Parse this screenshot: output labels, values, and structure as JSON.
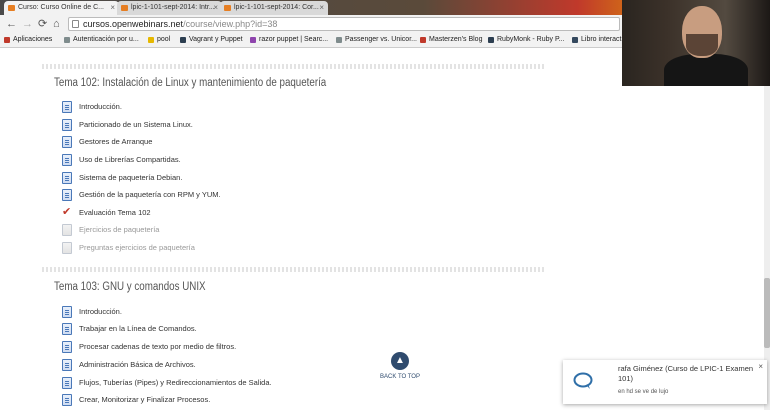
{
  "browser": {
    "tabs": [
      {
        "label": "Curso: Curso Online de C..."
      },
      {
        "label": "lpic-1-101-sept-2014: Intr..."
      },
      {
        "label": "lpic-1-101-sept-2014: Cor..."
      }
    ],
    "tab_close": "×",
    "url_domain": "cursos.openwebinars.net",
    "url_path": "/course/view.php?id=38",
    "nav": {
      "back": "←",
      "forward": "→",
      "reload": "⟳",
      "home": "⌂"
    },
    "bookmarks": [
      {
        "label": "Aplicaciones",
        "color": "#c0392b"
      },
      {
        "label": "Autenticación por u...",
        "color": "#7f8c8d"
      },
      {
        "label": "pool",
        "color": "#e6b800"
      },
      {
        "label": "Vagrant y Puppet",
        "color": "#2c3e50"
      },
      {
        "label": "razor puppet | Searc...",
        "color": "#8e44ad"
      },
      {
        "label": "Passenger vs. Unicor...",
        "color": "#7f8c8d"
      },
      {
        "label": "Masterzen's Blog",
        "color": "#c0392b"
      },
      {
        "label": "RubyMonk - Ruby P...",
        "color": "#2c3e50"
      },
      {
        "label": "Libro interact",
        "color": "#34495e"
      }
    ]
  },
  "sections": [
    {
      "title": "Tema 102: Instalación de Linux y mantenimiento de paquetería",
      "activities": [
        {
          "label": "Introducción.",
          "icon": "doc",
          "dim": false
        },
        {
          "label": "Particionado de un Sistema Linux.",
          "icon": "doc",
          "dim": false
        },
        {
          "label": "Gestores de Arranque",
          "icon": "doc",
          "dim": false
        },
        {
          "label": "Uso de Librerías Compartidas.",
          "icon": "doc",
          "dim": false
        },
        {
          "label": "Sistema de paquetería Debian.",
          "icon": "doc",
          "dim": false
        },
        {
          "label": "Gestión de la paquetería con RPM y YUM.",
          "icon": "doc",
          "dim": false
        },
        {
          "label": "Evaluación Tema 102",
          "icon": "quiz",
          "dim": false
        },
        {
          "label": "Ejercicios de paquetería",
          "icon": "gray",
          "dim": true
        },
        {
          "label": "Preguntas ejercicios de paquetería",
          "icon": "gray",
          "dim": true
        }
      ]
    },
    {
      "title": "Tema 103: GNU y comandos UNIX",
      "activities": [
        {
          "label": "Introducción.",
          "icon": "doc",
          "dim": false
        },
        {
          "label": "Trabajar en la Línea de Comandos.",
          "icon": "doc",
          "dim": false
        },
        {
          "label": "Procesar cadenas de texto por medio de filtros.",
          "icon": "doc",
          "dim": false
        },
        {
          "label": "Administración Básica de Archivos.",
          "icon": "doc",
          "dim": false
        },
        {
          "label": "Flujos, Tuberías (Pipes) y Redireccionamientos de Salida.",
          "icon": "doc",
          "dim": false
        },
        {
          "label": "Crear, Monitorizar y Finalizar Procesos.",
          "icon": "doc",
          "dim": false
        }
      ]
    }
  ],
  "back_to_top": {
    "label": "BACK TO TOP",
    "arrow": "▲"
  },
  "notification": {
    "name": "rafa Giménez (Curso de LPIC-1 Examen 101)",
    "message": "en hd se ve de lujo",
    "close": "×"
  }
}
